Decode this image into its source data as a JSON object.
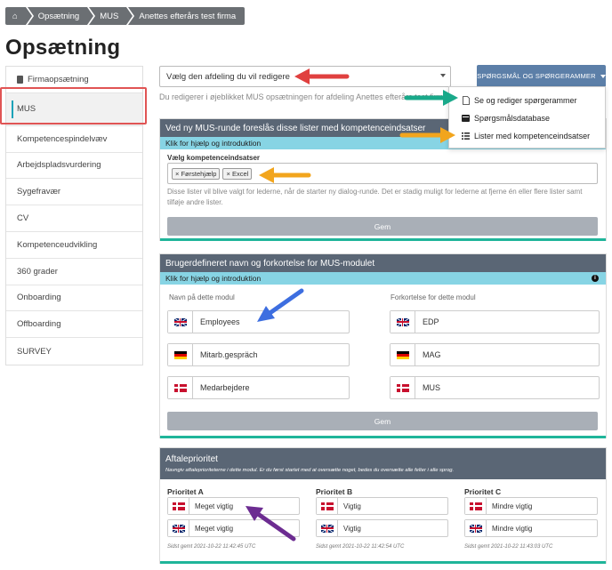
{
  "breadcrumb": {
    "home": "⌂",
    "items": [
      "Opsætning",
      "MUS",
      "Anettes efterårs test firma"
    ]
  },
  "page_title": "Opsætning",
  "sidebar": {
    "items": [
      {
        "label": "Firmaopsætning",
        "icon": "building-icon"
      },
      {
        "label": "MUS",
        "active": true
      },
      {
        "label": "Kompetencespindelvæv"
      },
      {
        "label": "Arbejdspladsvurdering"
      },
      {
        "label": "Sygefravær"
      },
      {
        "label": "CV"
      },
      {
        "label": "Kompetenceudvikling"
      },
      {
        "label": "360 grader"
      },
      {
        "label": "Onboarding"
      },
      {
        "label": "Offboarding"
      },
      {
        "label": "SURVEY"
      }
    ]
  },
  "department_select": {
    "value": "Vælg den afdeling du vil redigere"
  },
  "editing_hint": "Du redigerer i øjeblikket MUS opsætningen for afdeling Anettes efterårs test firma",
  "questions_dropdown": {
    "label": "SPØRGSMÅL OG SPØRGERAMMER",
    "items": [
      {
        "label": "Se og rediger spørgerammer",
        "icon": "document-icon"
      },
      {
        "label": "Spørgsmålsdatabase",
        "icon": "database-icon"
      },
      {
        "label": "Lister med kompetenceindsatser",
        "icon": "list-icon"
      }
    ]
  },
  "panel1": {
    "title": "Ved ny MUS-runde foreslås disse lister med kompetenceindsatser",
    "help": "Klik for hjælp og introduktion",
    "field_label": "Vælg kompetenceindsatser",
    "tags": [
      "× Førstehjælp",
      "× Excel"
    ],
    "description_line1": "Disse lister vil blive valgt for lederne, når de starter ny dialog-runde. Det er stadig muligt for lederne at fjerne én eller flere lister samt",
    "description_line2": "tilføje andre lister.",
    "save": "Gem"
  },
  "panel2": {
    "title": "Brugerdefineret navn og forkortelse for MUS-modulet",
    "help": "Klik for hjælp og introduktion",
    "name_label": "Navn på dette modul",
    "abbr_label": "Forkortelse for dette modul",
    "names": [
      {
        "flag": "uk",
        "value": "Employees"
      },
      {
        "flag": "de",
        "value": "Mitarb.gespräch"
      },
      {
        "flag": "dk",
        "value": "Medarbejdere"
      }
    ],
    "abbrs": [
      {
        "flag": "uk",
        "value": "EDP"
      },
      {
        "flag": "de",
        "value": "MAG"
      },
      {
        "flag": "dk",
        "value": "MUS"
      }
    ],
    "save": "Gem"
  },
  "panel3": {
    "title": "Aftaleprioritet",
    "subtitle": "Navngiv aftaleprioriteterne i dette modul. Er du først startet med at oversætte noget, bedes du oversætte alle felter i alle sprog.",
    "columns": [
      {
        "header": "Prioritet A",
        "dk": "Meget vigtig",
        "uk": "Meget vigtig",
        "saved": "Sidst gemt 2021-10-22 11:42:45 UTC"
      },
      {
        "header": "Prioritet B",
        "dk": "Vigtig",
        "uk": "Vigtig",
        "saved": "Sidst gemt 2021-10-22 11:42:54 UTC"
      },
      {
        "header": "Prioritet C",
        "dk": "Mindre vigtig",
        "uk": "Mindre vigtig",
        "saved": "Sidst gemt 2021-10-22 11:43:03 UTC"
      }
    ]
  },
  "annotation_colors": {
    "red": "#e0403f",
    "teal": "#19a98a",
    "orange": "#f2a51d",
    "blue": "#3d6ee0",
    "purple": "#6c2c91"
  }
}
